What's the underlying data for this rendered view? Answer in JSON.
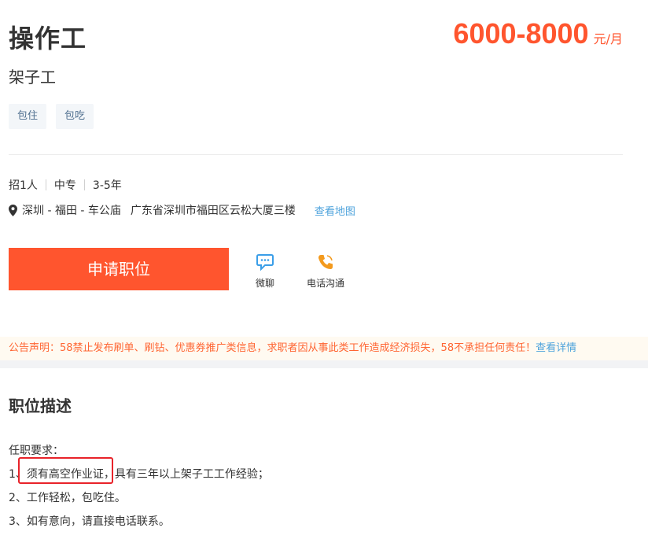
{
  "job": {
    "title": "操作工",
    "salary_value": "6000-8000",
    "salary_unit": "元/月",
    "subtitle": "架子工",
    "tags": [
      "包住",
      "包吃"
    ],
    "requirements": [
      "招1人",
      "中专",
      "3-5年"
    ],
    "location": {
      "area": "深圳 - 福田 - 车公庙",
      "address": "广东省深圳市福田区云松大厦三楼",
      "map_link": "查看地图"
    }
  },
  "actions": {
    "apply_label": "申请职位",
    "chat_label": "微聊",
    "phone_label": "电话沟通"
  },
  "notice": {
    "text": "公告声明：58禁止发布刷单、刷钻、优惠券推广类信息，求职者因从事此类工作造成经济损失，58不承担任何责任！",
    "link": "查看详情"
  },
  "description": {
    "heading": "职位描述",
    "lines": [
      "任职要求：",
      "1、须有高空作业证，具有三年以上架子工工作经验；",
      "2、工作轻松，包吃住。",
      "3、如有意向，请直接电话联系。"
    ]
  },
  "colors": {
    "accent": "#ff552e",
    "link": "#4ea3dc",
    "notice_text": "#ff6633",
    "highlight_border": "#e8232a"
  },
  "icons": {
    "location": "map-pin-icon",
    "chat": "chat-bubble-icon",
    "phone": "phone-icon"
  }
}
